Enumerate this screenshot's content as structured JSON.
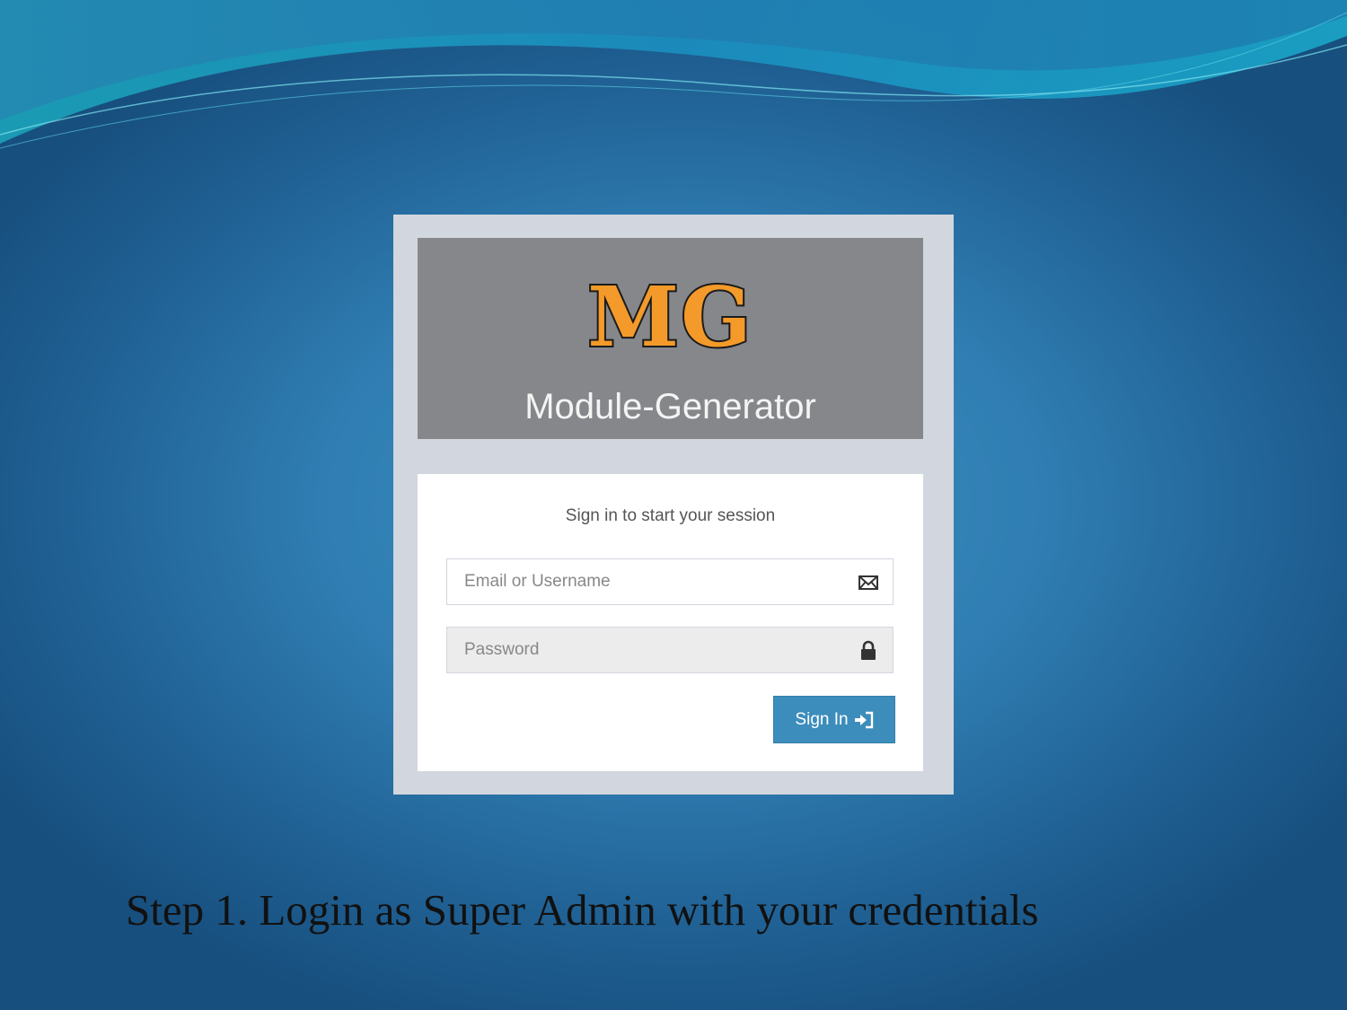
{
  "logo": {
    "mark": "MG",
    "title": "Module-Generator",
    "mark_color": "#f39a2a"
  },
  "login": {
    "message": "Sign in to start your session",
    "email": {
      "placeholder": "Email or Username",
      "value": "",
      "icon": "envelope-icon"
    },
    "password": {
      "placeholder": "Password",
      "value": "",
      "icon": "lock-icon"
    },
    "submit": {
      "label": "Sign In",
      "icon": "sign-in-icon",
      "color": "#3c8dbc"
    }
  },
  "caption": "Step 1.  Login as Super Admin with your credentials"
}
